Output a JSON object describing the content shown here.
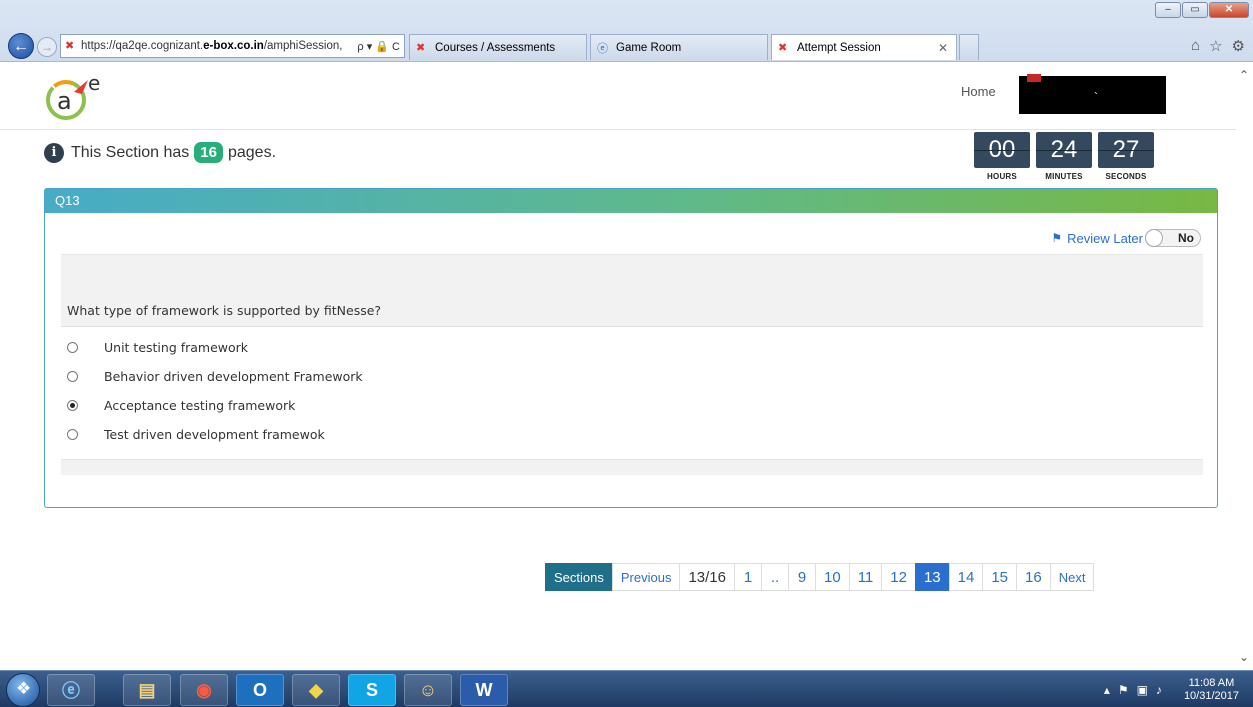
{
  "browser": {
    "url_prefix": "https://qa2qe.cognizant.",
    "url_domain": "e-box.co.in",
    "url_path": "/amphiSession,",
    "url_tools": "ρ ▾ 🔒 C",
    "tabs": [
      {
        "label": "Courses / Assessments"
      },
      {
        "label": "Game Room"
      },
      {
        "label": "Attempt Session"
      }
    ]
  },
  "header": {
    "home_label": "Home",
    "user_mark": "`"
  },
  "section_info": {
    "prefix": "This Section has",
    "page_count": "16",
    "suffix": "pages."
  },
  "timer": {
    "hours": "00",
    "minutes": "24",
    "seconds": "27",
    "hours_label": "HOURS",
    "minutes_label": "MINUTES",
    "seconds_label": "SECONDS"
  },
  "question": {
    "number": "Q13",
    "review_label": "Review Later",
    "review_value": "No",
    "text": "What type of framework is supported by fitNesse?",
    "options": [
      {
        "label": "Unit testing framework",
        "selected": false
      },
      {
        "label": "Behavior driven development Framework",
        "selected": false
      },
      {
        "label": "Acceptance testing framework",
        "selected": true
      },
      {
        "label": "Test driven development framewok",
        "selected": false
      }
    ]
  },
  "pagination": {
    "sections_label": "Sections",
    "previous_label": "Previous",
    "current_fraction": "13/16",
    "pages": [
      "1",
      "..",
      "9",
      "10",
      "11",
      "12",
      "13",
      "14",
      "15",
      "16"
    ],
    "active_page": "13",
    "next_label": "Next"
  },
  "taskbar": {
    "time": "11:08 AM",
    "date": "10/31/2017"
  },
  "colors": {
    "accent": "#2a6fcf",
    "badge_green": "#27ae7a",
    "timer_bg": "#34495e",
    "sections_btn": "#1f6f8b"
  }
}
